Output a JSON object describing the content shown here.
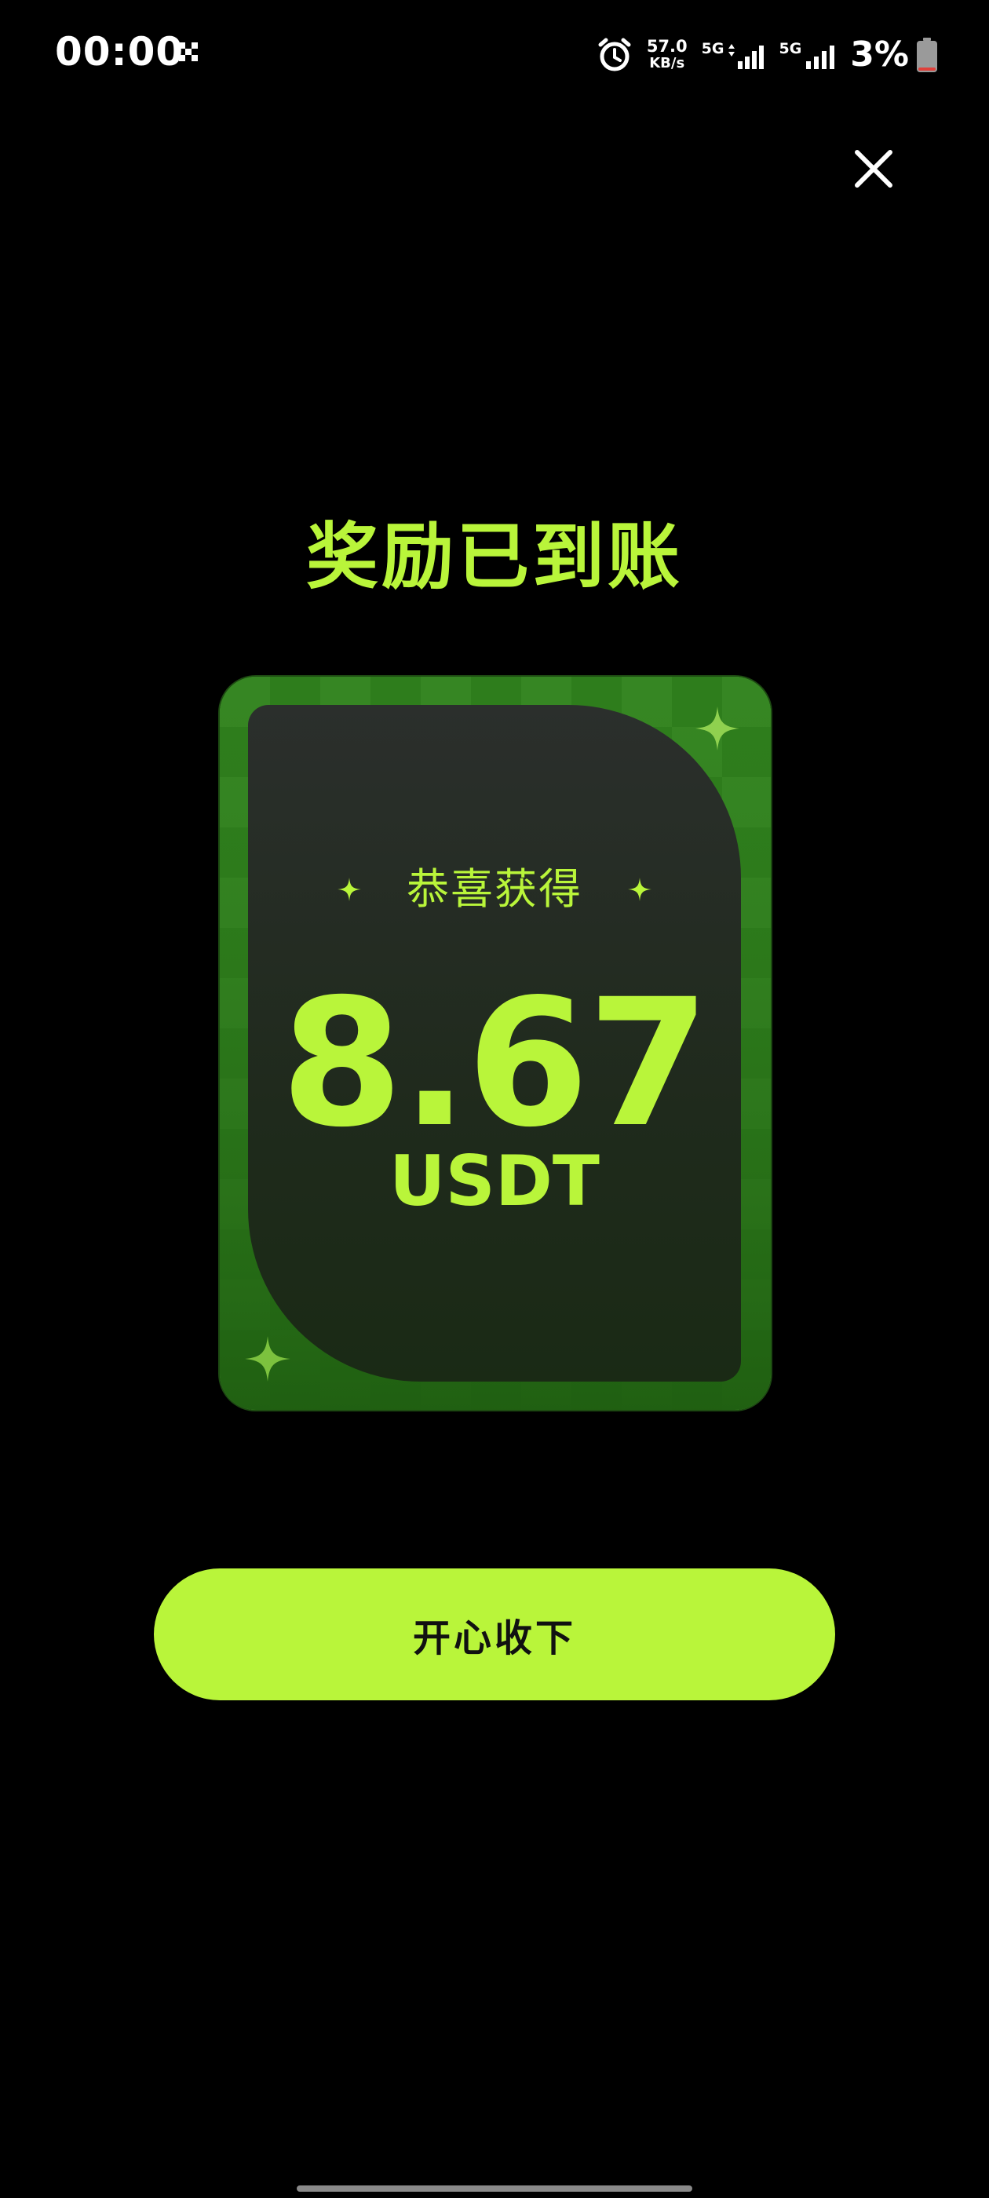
{
  "status_bar": {
    "time": "00:00",
    "net_speed_value": "57.0",
    "net_speed_unit": "KB/s",
    "sim1_label": "5G",
    "sim2_label": "5G",
    "battery_percent": "3%",
    "icons": [
      "notification-icon",
      "alarm-icon",
      "signal-icon",
      "signal-icon",
      "battery-low-icon"
    ]
  },
  "close_button": {
    "icon": "close-icon"
  },
  "title": "奖励已到账",
  "card": {
    "congrats": "恭喜获得",
    "amount": "8.67",
    "currency": "USDT"
  },
  "accept_button": {
    "label": "开心收下"
  },
  "colors": {
    "accent": "#b9f53a",
    "card_green": "#2e7d1c",
    "background": "#000000",
    "battery_low": "#e0403a"
  }
}
